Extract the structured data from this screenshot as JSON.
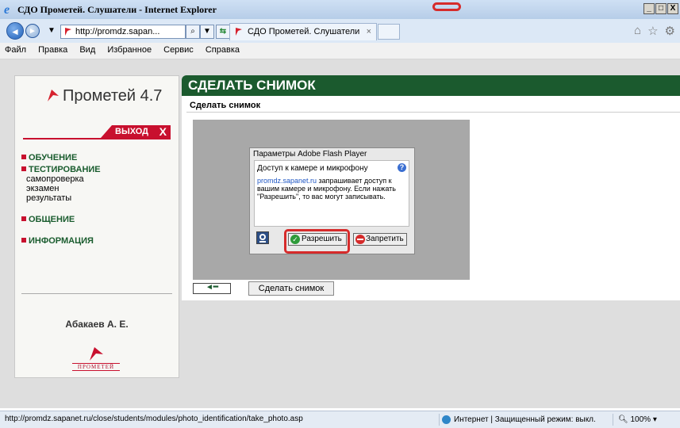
{
  "window": {
    "title": "СДО Прометей. Слушатели - Internet Explorer",
    "controls": [
      "_",
      "□",
      "X"
    ]
  },
  "addressbar": {
    "url": "http://promdz.sapan...",
    "tab_title": "СДО Прометей. Слушатели",
    "tab_close": "×"
  },
  "menubar": [
    "Файл",
    "Правка",
    "Вид",
    "Избранное",
    "Сервис",
    "Справка"
  ],
  "sidebar": {
    "logo": "Прометей 4.7",
    "exit_label": "ВЫХОД",
    "exit_icon": "X",
    "menu": [
      {
        "label": "ОБУЧЕНИЕ",
        "sub": []
      },
      {
        "label": "ТЕСТИРОВАНИЕ",
        "sub": [
          "самопроверка",
          "экзамен",
          "результаты"
        ]
      },
      {
        "label": "ОБЩЕНИЕ",
        "sub": []
      },
      {
        "label": "ИНФОРМАЦИЯ",
        "sub": []
      }
    ],
    "user_name": "Абакаев А. Е.",
    "bottom_logo_text": "ПРОМЕТЕЙ"
  },
  "main": {
    "heading": "СДЕЛАТЬ СНИМОК",
    "subheading": "Сделать снимок",
    "back_label": "◄━",
    "snapshot_button": "Сделать снимок"
  },
  "flash_dialog": {
    "title": "Параметры Adobe Flash Player",
    "header": "Доступ к камере и микрофону",
    "help_icon": "?",
    "link": "promdz.sapanet.ru",
    "text": " запрашивает доступ к вашим камере и микрофону. Если нажать \"Разрешить\", то вас могут записывать.",
    "allow_label": "Разрешить",
    "deny_label": "Запретить"
  },
  "statusbar": {
    "url": "http://promdz.sapanet.ru/close/students/modules/photo_identification/take_photo.asp",
    "zone": "Интернет | Защищенный режим: выкл.",
    "zoom": "100%"
  },
  "colors": {
    "heading_bg": "#1b5a2e",
    "accent_red": "#c8102e",
    "highlight": "#d62b2b"
  }
}
